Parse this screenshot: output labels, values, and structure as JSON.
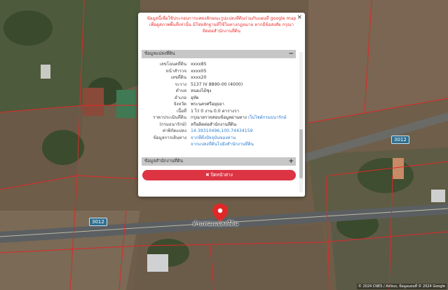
{
  "popup": {
    "close_symbol": "×",
    "notice": "ข้อมูลนี้เพื่อใช้ประกอบการแสดงลักษณะรูปแปลงที่ดินร่วมกับแผนที่ google map เพื่อดูสภาพพื้นที่เท่านั้น มิใช่หลักฐานที่ใช้ในทางกฎหมาย หากมีข้อสงสัย กรุณาติดต่อสำนักงานที่ดิน",
    "section_parcel": "ข้อมูลแปลงที่ดิน",
    "section_parcel_sign": "−",
    "rows": [
      {
        "key": "เลขโฉนดที่ดิน",
        "value": "xxxx85"
      },
      {
        "key": "หน้าสำรวจ",
        "value": "xxxx05"
      },
      {
        "key": "เลขที่ดิน",
        "value": "xxxx20"
      },
      {
        "key": "ระวาง",
        "value": "5137 IV 8890-00 (4000)"
      },
      {
        "key": "ตำบล",
        "value": "หนองไม้ซุง"
      },
      {
        "key": "อำเภอ",
        "value": "อุทัย"
      },
      {
        "key": "จังหวัด",
        "value": "พระนครศรีอยุธยา"
      },
      {
        "key": "เนื้อที่",
        "value": "1 ไร่ 0 งาน 0.0 ตารางวา"
      }
    ],
    "appraisal_key_1": "ราคาประเมินที่ดิน",
    "appraisal_key_2": "(กรมธนารักษ์)",
    "appraisal_value_1": "กรุณาตรวจสอบข้อมูลผ่านทาง",
    "appraisal_link": "เว็บไซต์กรมธนารักษ์",
    "appraisal_value_2": "หรือติดต่อสำนักงานที่ดิน",
    "coord_key": "ค่าพิกัดแปลง",
    "coord_value": "14.39310496,100.74434159",
    "office_key": "ข้อมูลการเดินทาง",
    "office_link_1": "จากที่ตั้งปัจจุบันของท่าน",
    "office_link_2": "จากแปลงที่ดินไปยังสำนักงานที่ดิน",
    "section_office": "ข้อมูลสำนักงานที่ดิน",
    "section_office_sign": "+",
    "close_button": "✖ ปิดหน้าต่าง"
  },
  "map": {
    "road_label_1": "3012",
    "road_label_2": "3012",
    "pin_label": "ตำแหน่งแปลงที่ดิน",
    "attribution": "© 2024 CNES / Airbus, ข้อมูลแผนที่ © 2024 Google"
  }
}
